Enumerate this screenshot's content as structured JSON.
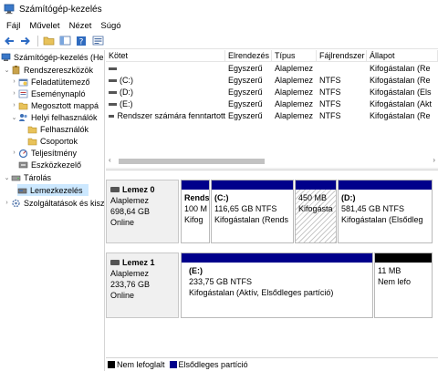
{
  "window": {
    "title": "Számítógép-kezelés"
  },
  "menu": [
    "Fájl",
    "Művelet",
    "Nézet",
    "Súgó"
  ],
  "tree": {
    "root": "Számítógép-kezelés (He",
    "items": [
      {
        "label": "Rendszereszközök",
        "icon": "tools-icon"
      },
      {
        "label": "Feladatütemező",
        "icon": "task-scheduler-icon"
      },
      {
        "label": "Eseménynapló",
        "icon": "event-viewer-icon"
      },
      {
        "label": "Megosztott mappá",
        "icon": "shared-folder-icon"
      },
      {
        "label": "Helyi felhasználók",
        "icon": "users-icon"
      },
      {
        "label": "Felhasználók",
        "icon": "folder-icon"
      },
      {
        "label": "Csoportok",
        "icon": "folder-icon"
      },
      {
        "label": "Teljesítmény",
        "icon": "performance-icon"
      },
      {
        "label": "Eszközkezelő",
        "icon": "device-manager-icon"
      },
      {
        "label": "Tárolás",
        "icon": "storage-icon"
      },
      {
        "label": "Lemezkezelés",
        "icon": "disk-management-icon"
      },
      {
        "label": "Szolgáltatások és kisz",
        "icon": "services-icon"
      }
    ]
  },
  "volume_list": {
    "columns": [
      "Kötet",
      "Elrendezés",
      "Típus",
      "Fájlrendszer",
      "Állapot"
    ],
    "rows": [
      [
        "",
        "Egyszerű",
        "Alaplemez",
        "",
        "Kifogástalan (Re"
      ],
      [
        "(C:)",
        "Egyszerű",
        "Alaplemez",
        "NTFS",
        "Kifogástalan (Re"
      ],
      [
        "(D:)",
        "Egyszerű",
        "Alaplemez",
        "NTFS",
        "Kifogástalan (Els"
      ],
      [
        "(E:)",
        "Egyszerű",
        "Alaplemez",
        "NTFS",
        "Kifogástalan (Akt"
      ],
      [
        "Rendszer számára fenntartott",
        "Egyszerű",
        "Alaplemez",
        "NTFS",
        "Kifogástalan (Re"
      ]
    ]
  },
  "disks": [
    {
      "name": "Lemez 0",
      "type": "Alaplemez",
      "size": "698,64 GB",
      "status": "Online",
      "partitions": [
        {
          "name": "Rends",
          "size": "100 M",
          "status": "Kifog"
        },
        {
          "name": "(C:)",
          "size": "116,65 GB NTFS",
          "status": "Kifogástalan (Rends"
        },
        {
          "name": "",
          "size": "450 MB",
          "status": "Kifogásta"
        },
        {
          "name": "(D:)",
          "size": "581,45 GB NTFS",
          "status": "Kifogástalan (Elsődleg"
        }
      ]
    },
    {
      "name": "Lemez 1",
      "type": "Alaplemez",
      "size": "233,76 GB",
      "status": "Online",
      "partitions": [
        {
          "name": "(E:)",
          "size": "233,75 GB NTFS",
          "status": "Kifogástalan (Aktív, Elsődleges partíció)"
        },
        {
          "name": "",
          "size": "11 MB",
          "status": "Nem lefo"
        }
      ]
    }
  ],
  "legend": [
    {
      "label": "Nem lefoglalt",
      "color": "#000000"
    },
    {
      "label": "Elsődleges partíció",
      "color": "#00008b"
    }
  ]
}
